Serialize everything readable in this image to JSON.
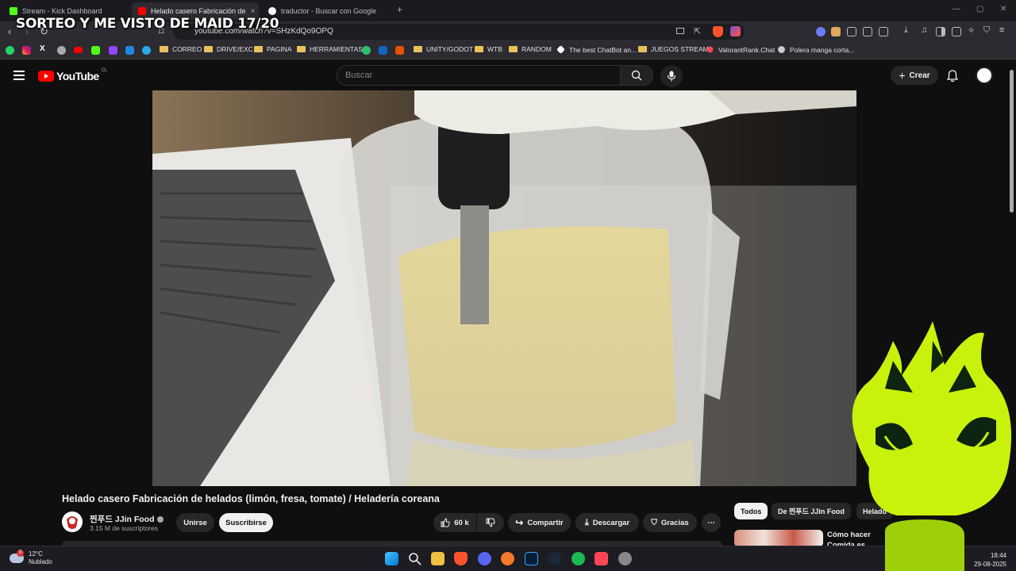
{
  "overlay_title": "SORTEO Y ME VISTO DE MAID 17/20",
  "tabs": [
    {
      "label": "Stream - Kick Dashboard",
      "icon": "kick-icon",
      "active": false
    },
    {
      "label": "Helado casero Fabricación de",
      "icon": "youtube-icon",
      "active": true
    },
    {
      "label": "traductor - Buscar con Google",
      "icon": "google-icon",
      "active": false
    }
  ],
  "browser": {
    "url": "youtube.com/watch?v=SHzKdQo9OPQ",
    "new_tab": "+",
    "tab_close": "×"
  },
  "bookmarks": [
    {
      "label": "CORREO",
      "type": "folder"
    },
    {
      "label": "DRIVE/EXC",
      "type": "folder"
    },
    {
      "label": "PAGINA",
      "type": "folder"
    },
    {
      "label": "HERRAMIENTAS",
      "type": "folder"
    },
    {
      "label": "UNITY/GODOT",
      "type": "folder"
    },
    {
      "label": "WTB",
      "type": "folder"
    },
    {
      "label": "RANDOM",
      "type": "folder"
    },
    {
      "label": "The best ChatBot an...",
      "type": "link"
    },
    {
      "label": "JUEGOS STREAM",
      "type": "folder"
    },
    {
      "label": "ValorantRank.Chat",
      "type": "link"
    },
    {
      "label": "Polera manga corta...",
      "type": "link"
    }
  ],
  "youtube": {
    "logo_text": "YouTube",
    "country_code": "CL",
    "search_placeholder": "Buscar",
    "create_label": "Crear"
  },
  "video": {
    "title": "Helado casero Fabricación de helados (limón, fresa, tomate) / Heladería coreana",
    "channel": "찐푸드 JJin Food",
    "subscribers": "3.15 M de suscriptores",
    "join_label": "Unirse",
    "subscribe_label": "Suscribirse",
    "likes": "60 k",
    "share_label": "Compartir",
    "download_label": "Descargar",
    "thanks_label": "Gracias"
  },
  "chips": [
    "Todos",
    "De 찐푸드 JJin Food",
    "Helado"
  ],
  "recommendation": {
    "title": "Cómo hacer Comida es"
  },
  "taskbar": {
    "weather_temp": "12°C",
    "weather_desc": "Nublado",
    "weather_badge": "3",
    "time": "18:44",
    "date": "29-08-2025"
  },
  "colors": {
    "youtube_red": "#ff0000",
    "mascot_green": "#c8f20c",
    "background": "#0f0f0f"
  }
}
